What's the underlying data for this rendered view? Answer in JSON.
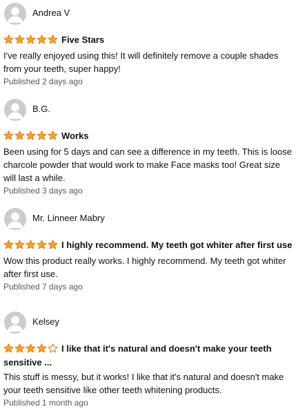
{
  "colors": {
    "star_fill": "#ffa41c",
    "star_stroke": "#de7921",
    "star_empty": "#ffffff",
    "meta_text": "#565959",
    "avatar_bg": "#c9cdd2"
  },
  "reviews": [
    {
      "author": "Andrea V",
      "avatar_icon": "default-user-avatar-icon",
      "rating": 5,
      "max_rating": 5,
      "title": "Five Stars",
      "body": "I've really enjoyed using this! It will definitely remove a couple shades from your teeth, super happy!",
      "published": "Published 2 days ago"
    },
    {
      "author": "B.G.",
      "avatar_icon": "default-user-avatar-icon",
      "rating": 5,
      "max_rating": 5,
      "title": "Works",
      "body": "Been using for 5 days and can see a difference in my teeth. This is loose charcole powder that would work to make Face masks too! Great size will last a while.",
      "published": "Published 3 days ago"
    },
    {
      "author": "Mr. Linneer Mabry",
      "avatar_icon": "default-user-avatar-icon",
      "rating": 5,
      "max_rating": 5,
      "title": "I highly recommend. My teeth got whiter after first use",
      "body": "Wow this product really works. I highly recommend. My teeth got whiter after first use.",
      "published": "Published 7 days ago"
    },
    {
      "author": "Kelsey",
      "avatar_icon": "default-user-avatar-icon",
      "rating": 4,
      "max_rating": 5,
      "title": "I like that it's natural and doesn't make your teeth sensitive ...",
      "body": "This stuff is messy, but it works! I like that it's natural and doesn't make your teeth sensitive like other teeth whitening products.",
      "published": "Published 1 month ago"
    }
  ]
}
